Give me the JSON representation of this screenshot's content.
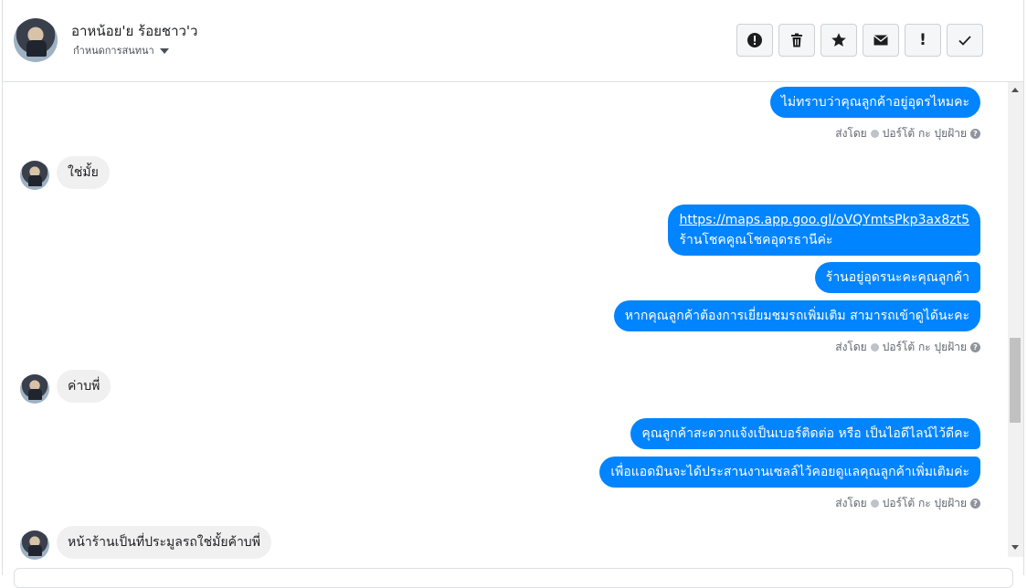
{
  "header": {
    "contact_name": "อาหน้อย'ย ร้อยชาว'ว",
    "assign_label": "กำหนดการสนทนา",
    "actions": [
      "spam-icon",
      "trash-icon",
      "star-icon",
      "envelope-icon",
      "follow-up-icon",
      "check-icon"
    ],
    "follow_up_glyph": "!"
  },
  "sent_by": {
    "prefix": "ส่งโดย",
    "name": "ปอร์โต้ กะ ปุยฝ้าย"
  },
  "messages": [
    {
      "dir": "out",
      "text": "ไม่ทราบว่าคุณลูกค้าอยู่อุดรไหมคะ"
    },
    {
      "dir": "in",
      "text": "ใช่มั้ย"
    },
    {
      "dir": "out",
      "link": "https://maps.app.goo.gl/oVQYmtsPkp3ax8zt5",
      "text": "ร้านโชคคูณโชคอุดรธานีค่ะ"
    },
    {
      "dir": "out",
      "text": "ร้านอยู่อุดรนะคะคุณลูกค้า"
    },
    {
      "dir": "out",
      "text": "หากคุณลูกค้าต้องการเยี่ยมชมรถเพิ่มเติม สามารถเข้าดูได้นะคะ"
    },
    {
      "dir": "in",
      "text": "ค่าบพี่"
    },
    {
      "dir": "out",
      "text": "คุณลูกค้าสะดวกแจ้งเป็นเบอร์ติดต่อ หรือ เป็นไอดีไลน์ไว้ดีคะ"
    },
    {
      "dir": "out",
      "text": "เพื่อแอดมินจะได้ประสานงานเซลล์ไว้คอยดูแลคุณลูกค้าเพิ่มเติมค่ะ"
    },
    {
      "dir": "in",
      "text": "หน้าร้านเป็นที่ประมูลรถใช่มั้ยค้าบพี่"
    }
  ],
  "colors": {
    "outgoing": "#0084ff",
    "incoming": "#f1f0f0"
  }
}
